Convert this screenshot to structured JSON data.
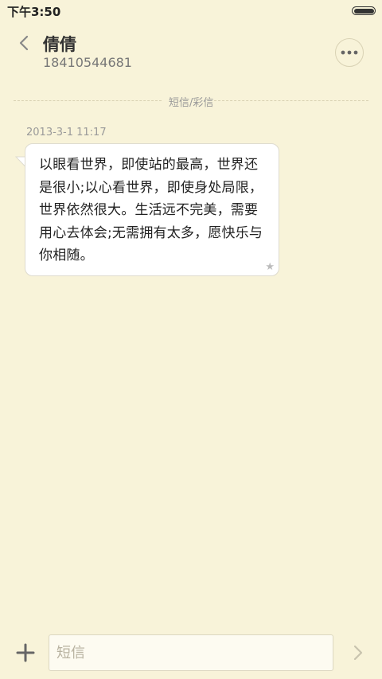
{
  "status_bar": {
    "time": "下午3:50"
  },
  "header": {
    "contact_name": "倩倩",
    "contact_number": "18410544681",
    "back_icon": "chevron-left-icon",
    "more_icon": "more-dots-icon"
  },
  "thread": {
    "divider_label": "短信/彩信",
    "messages": [
      {
        "timestamp": "2013-3-1 11:17",
        "text": "以眼看世界，即使站的最高，世界还是很小;以心看世界，即使身处局限，世界依然很大。生活远不完美，需要用心去体会;无需拥有太多，愿快乐与你相随。",
        "starred_icon": "star-icon"
      }
    ]
  },
  "composer": {
    "placeholder": "短信",
    "value": "",
    "add_icon": "plus-icon",
    "send_icon": "chevron-right-icon"
  },
  "colors": {
    "background": "#f8f3d9",
    "bubble": "#ffffff",
    "secondary_text": "#999999"
  }
}
